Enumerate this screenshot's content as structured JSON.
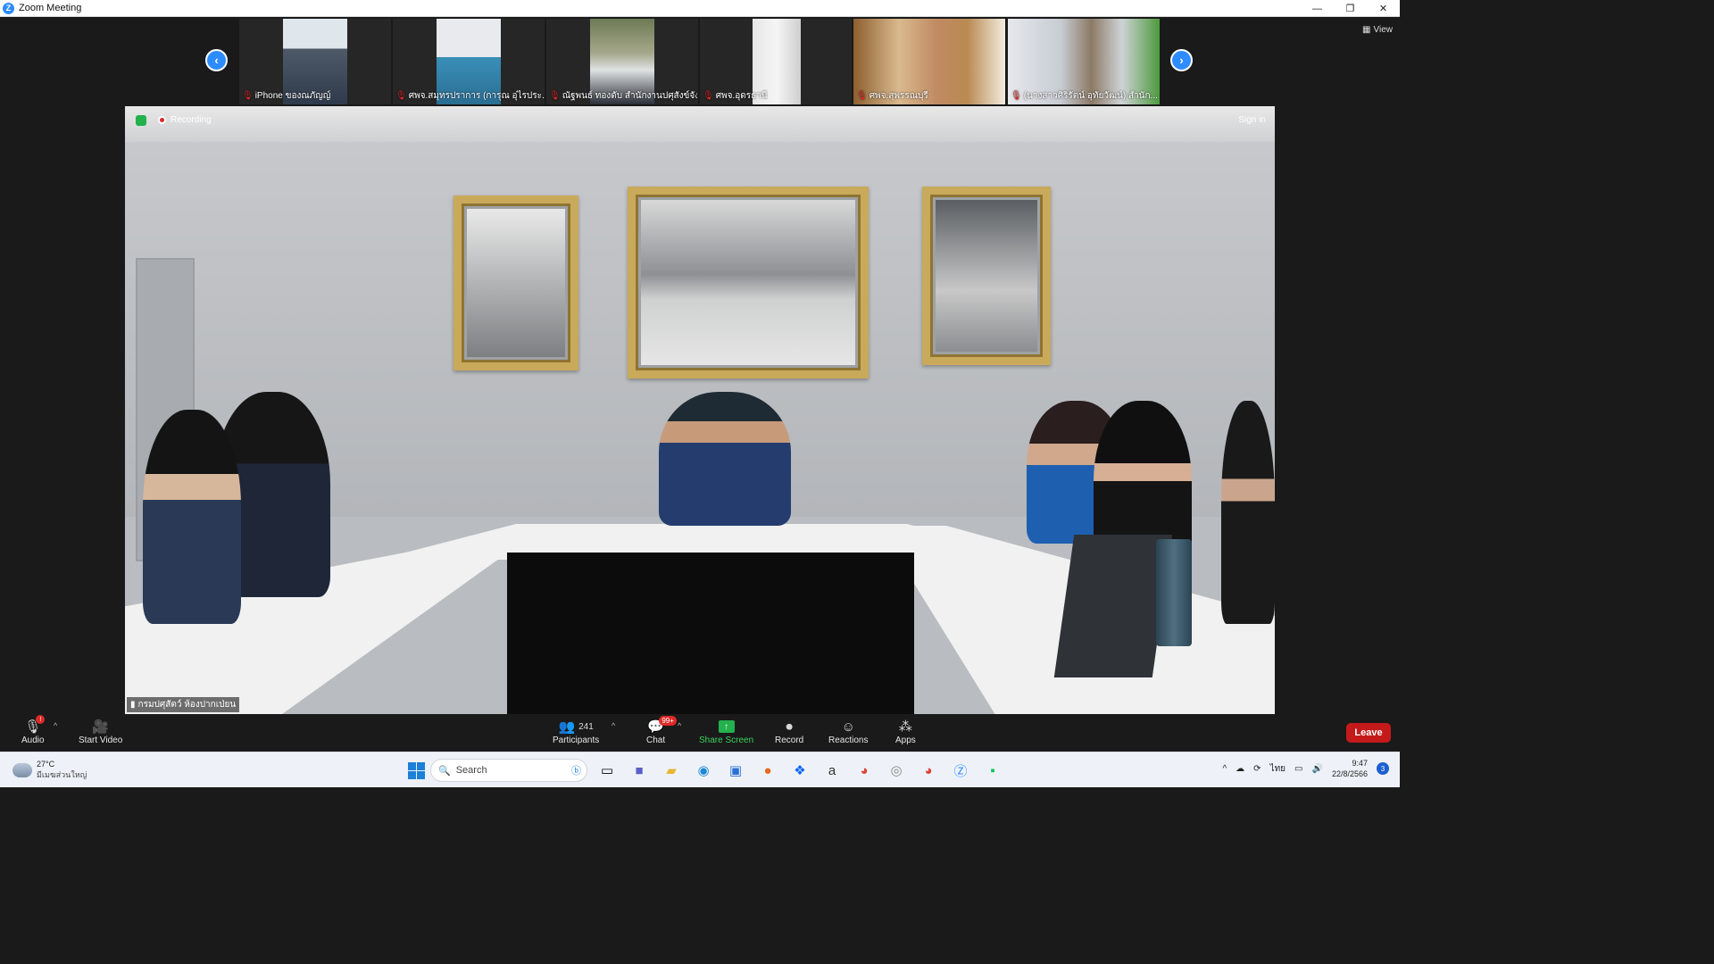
{
  "window": {
    "title": "Zoom Meeting",
    "minimize": "—",
    "restore": "❐",
    "close": "✕"
  },
  "gallery": {
    "view_label": "View",
    "tiles": [
      {
        "name": "iPhone ของณภัญญ์"
      },
      {
        "name": "ศพจ.สมุทรปราการ (การุณ อุ่ไรประ..."
      },
      {
        "name": "ณัฐพนธ์ ทองดับ สำนักงานปศุสังข์จัง..."
      },
      {
        "name": "ศพจ.อุดรธานี"
      },
      {
        "name": "ศพจ.สุพรรณบุรี"
      },
      {
        "name": "(นางสาวศิริรัตน์ อุทัยวัฒน์) สำนัก..."
      }
    ]
  },
  "main_video": {
    "recording_label": "Recording",
    "sign_in": "Sign in",
    "speaker_name": "กรมปศุสัตว์ ห้องปากเป่ยน"
  },
  "controls": {
    "audio": "Audio",
    "audio_badge": "!",
    "start_video": "Start Video",
    "participants": "Participants",
    "participants_count": "241",
    "chat": "Chat",
    "chat_badge": "99+",
    "share_screen": "Share Screen",
    "record": "Record",
    "reactions": "Reactions",
    "apps": "Apps",
    "leave": "Leave"
  },
  "taskbar": {
    "weather_temp": "27°C",
    "weather_desc": "มีเมฆส่วนใหญ่",
    "search_placeholder": "Search",
    "lang": "ไทย",
    "time": "9:47",
    "date": "22/8/2566",
    "notifications": "3"
  },
  "colors": {
    "accent": "#2d8cff",
    "leave": "#c41a1a",
    "share": "#23b14d"
  }
}
